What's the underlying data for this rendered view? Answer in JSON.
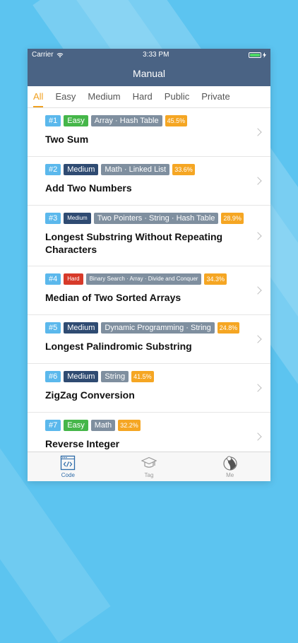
{
  "status": {
    "carrier": "Carrier",
    "time": "3:33 PM"
  },
  "nav": {
    "title": "Manual"
  },
  "filters": [
    {
      "label": "All",
      "active": true
    },
    {
      "label": "Easy",
      "active": false
    },
    {
      "label": "Medium",
      "active": false
    },
    {
      "label": "Hard",
      "active": false
    },
    {
      "label": "Public",
      "active": false
    },
    {
      "label": "Private",
      "active": false
    }
  ],
  "problems": [
    {
      "num": "#1",
      "difficulty": "Easy",
      "topics": "Array · Hash Table",
      "rate": "45.5%",
      "title": "Two Sum"
    },
    {
      "num": "#2",
      "difficulty": "Medium",
      "topics": "Math · Linked List",
      "rate": "33.6%",
      "title": "Add Two Numbers"
    },
    {
      "num": "#3",
      "difficulty": "Medium",
      "topics": "Two Pointers · String · Hash Table",
      "rate": "28.9%",
      "title": "Longest Substring Without Repeating Characters"
    },
    {
      "num": "#4",
      "difficulty": "Hard",
      "topics": "Binary Search · Array · Divide and Conquer",
      "rate": "34.3%",
      "title": "Median of Two Sorted Arrays"
    },
    {
      "num": "#5",
      "difficulty": "Medium",
      "topics": "Dynamic Programming · String",
      "rate": "24.8%",
      "title": "Longest Palindromic Substring"
    },
    {
      "num": "#6",
      "difficulty": "Medium",
      "topics": "String",
      "rate": "41.5%",
      "title": "ZigZag Conversion"
    },
    {
      "num": "#7",
      "difficulty": "Easy",
      "topics": "Math",
      "rate": "32.2%",
      "title": "Reverse Integer"
    }
  ],
  "tabbar": [
    {
      "label": "Code",
      "icon": "code-icon",
      "active": true
    },
    {
      "label": "Tag",
      "icon": "tag-icon",
      "active": false
    },
    {
      "label": "Me",
      "icon": "me-icon",
      "active": false
    }
  ],
  "colors": {
    "nav": "#4a6384",
    "accent": "#f0a020",
    "easy": "#45b649",
    "medium": "#2f4b72",
    "hard": "#d73a2a",
    "tabActive": "#2c6aa8"
  }
}
